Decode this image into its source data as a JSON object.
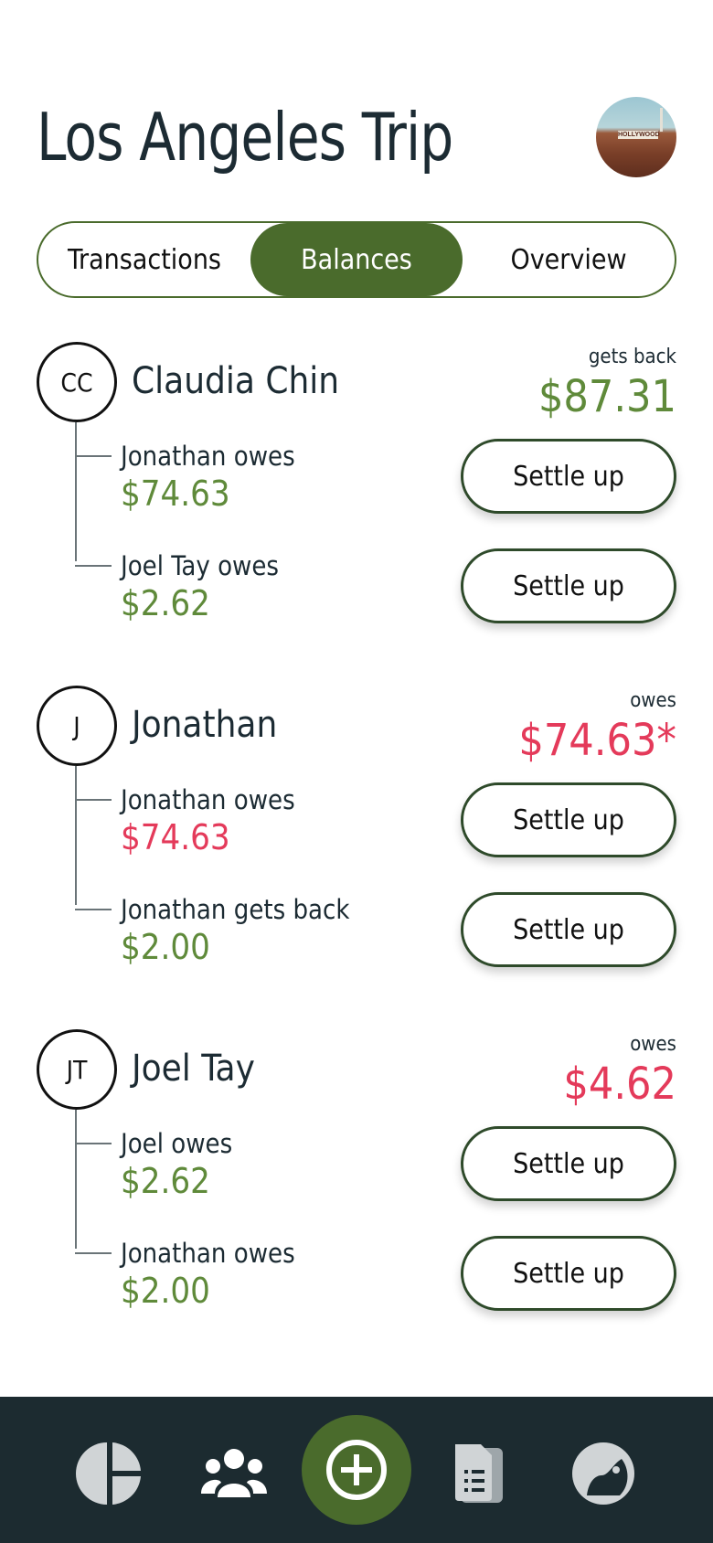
{
  "header": {
    "title": "Los Angeles Trip",
    "avatar_caption": "HOLLYWOOD"
  },
  "tabs": [
    {
      "label": "Transactions",
      "active": false
    },
    {
      "label": "Balances",
      "active": true
    },
    {
      "label": "Overview",
      "active": false
    }
  ],
  "people": [
    {
      "initials": "CC",
      "name": "Claudia Chin",
      "status_label": "gets back",
      "status_amount": "$87.31",
      "status_color": "#5f8a3a",
      "rows": [
        {
          "label": "Jonathan owes",
          "amount": "$74.63",
          "amount_color": "#5f8a3a",
          "button": "Settle up"
        },
        {
          "label": "Joel Tay owes",
          "amount": "$2.62",
          "amount_color": "#5f8a3a",
          "button": "Settle up"
        }
      ]
    },
    {
      "initials": "J",
      "name": "Jonathan",
      "status_label": "owes",
      "status_amount": "$74.63*",
      "status_color": "#e43a5a",
      "rows": [
        {
          "label": "Jonathan owes",
          "amount": "$74.63",
          "amount_color": "#e43a5a",
          "button": "Settle up"
        },
        {
          "label": "Jonathan gets back",
          "amount": "$2.00",
          "amount_color": "#5f8a3a",
          "button": "Settle up"
        }
      ]
    },
    {
      "initials": "JT",
      "name": "Joel Tay",
      "status_label": "owes",
      "status_amount": "$4.62",
      "status_color": "#e43a5a",
      "rows": [
        {
          "label": "Joel owes",
          "amount": "$2.62",
          "amount_color": "#5f8a3a",
          "button": "Settle up"
        },
        {
          "label": "Jonathan owes",
          "amount": "$2.00",
          "amount_color": "#5f8a3a",
          "button": "Settle up"
        }
      ]
    }
  ],
  "bottom_nav": {
    "items": [
      {
        "icon": "pie-chart-icon"
      },
      {
        "icon": "group-icon"
      },
      {
        "icon": "add-circle-icon"
      },
      {
        "icon": "documents-icon"
      },
      {
        "icon": "profile-icon"
      }
    ]
  },
  "colors": {
    "accent": "#4a6b2c",
    "positive": "#5f8a3a",
    "negative": "#e43a5a",
    "nav_bg": "#1c2b30"
  }
}
